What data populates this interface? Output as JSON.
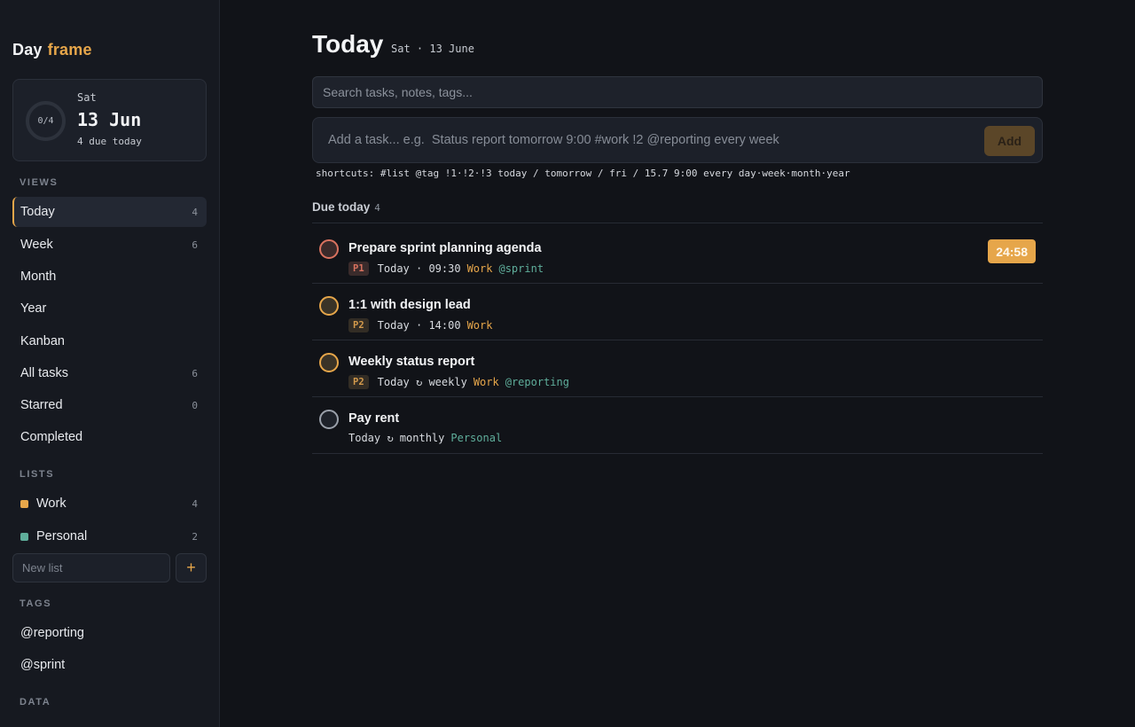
{
  "brand": {
    "part1": "Day",
    "part2": "frame"
  },
  "day_card": {
    "progress": "0/4",
    "dow": "Sat",
    "date": "13 Jun",
    "due": "4 due today"
  },
  "views_label": "VIEWS",
  "views": [
    {
      "label": "Today",
      "count": "4"
    },
    {
      "label": "Week",
      "count": "6"
    },
    {
      "label": "Month",
      "count": ""
    },
    {
      "label": "Year",
      "count": ""
    },
    {
      "label": "Kanban",
      "count": ""
    },
    {
      "label": "All tasks",
      "count": "6"
    },
    {
      "label": "Starred",
      "count": "0"
    },
    {
      "label": "Completed",
      "count": ""
    }
  ],
  "lists_label": "LISTS",
  "lists": [
    {
      "label": "Work",
      "count": "4",
      "color": "#e6a64a"
    },
    {
      "label": "Personal",
      "count": "2",
      "color": "#5fae9b"
    }
  ],
  "new_list_placeholder": "New list",
  "add_list_label": "+",
  "tags_label": "TAGS",
  "tags": [
    {
      "label": "@reporting"
    },
    {
      "label": "@sprint"
    }
  ],
  "data_label": "DATA",
  "header": {
    "title": "Today",
    "subtitle": "Sat · 13 June"
  },
  "search_placeholder": "Search tasks, notes, tags...",
  "add_task": {
    "placeholder": "Add a task... e.g.  Status report tomorrow 9:00 #work !2 @reporting every week",
    "button": "Add"
  },
  "shortcuts": "shortcuts: #list @tag !1·!2·!3 today / tomorrow / fri / 15.7 9:00 every day·week·month·year",
  "group": {
    "title": "Due today",
    "count": "4"
  },
  "tasks": [
    {
      "title": "Prepare sprint planning agenda",
      "priority": "P1",
      "when": "Today · 09:30",
      "list": "Work",
      "tag": "@sprint",
      "timer": "24:58",
      "check_color": "#d9725f",
      "prio_color": "#d9725f",
      "list_color": "#e6a64a"
    },
    {
      "title": "1:1 with design lead",
      "priority": "P2",
      "when": "Today · 14:00",
      "list": "Work",
      "tag": "",
      "timer": "",
      "check_color": "#e6a64a",
      "prio_color": "#d39a4c",
      "list_color": "#e6a64a"
    },
    {
      "title": "Weekly status report",
      "priority": "P2",
      "when": "Today ↻ weekly",
      "list": "Work",
      "tag": "@reporting",
      "timer": "",
      "check_color": "#e6a64a",
      "prio_color": "#d39a4c",
      "list_color": "#e6a64a"
    },
    {
      "title": "Pay rent",
      "priority": "",
      "when": "Today ↻ monthly",
      "list": "Personal",
      "tag": "",
      "timer": "",
      "check_color": "#9aa0aa",
      "prio_color": "",
      "list_color": "#5fae9b"
    }
  ]
}
